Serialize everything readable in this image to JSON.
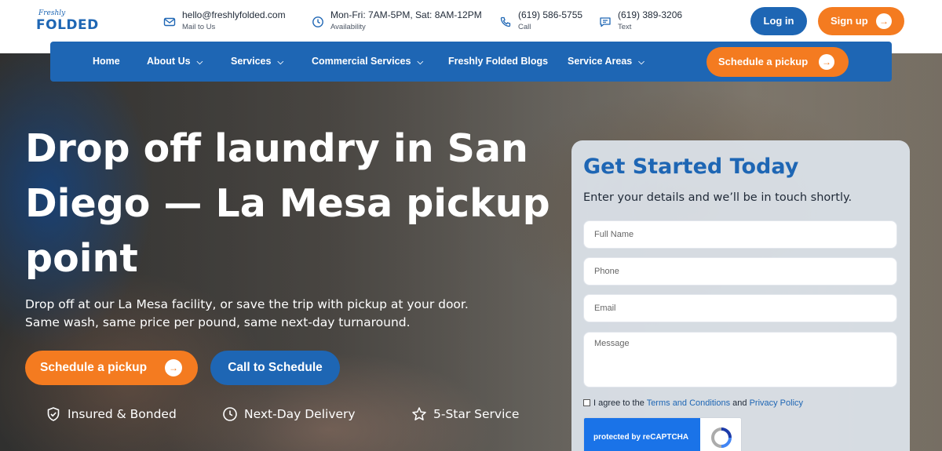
{
  "brand": {
    "logo_script": "Freshly",
    "logo_main": "FOLDED",
    "color_primary": "#1e66b4",
    "color_accent": "#f47b20"
  },
  "contacts": [
    {
      "icon": "mail-icon",
      "text": "hello@freshlyfolded.com",
      "sub": "Mail to Us"
    },
    {
      "icon": "clock-icon",
      "text": "Mon-Fri: 7AM-5PM, Sat: 8AM-12PM",
      "sub": "Availability"
    },
    {
      "icon": "phone-icon",
      "text": "(619) 586-5755",
      "sub": "Call"
    },
    {
      "icon": "message-icon",
      "text": "(619) 389-3206",
      "sub": "Text"
    }
  ],
  "header": {
    "login_label": "Log in",
    "signup_label": "Sign up"
  },
  "nav": {
    "items": [
      {
        "label": "Home",
        "dropdown": false
      },
      {
        "label": "About Us",
        "dropdown": true
      },
      {
        "label": "Services",
        "dropdown": true
      },
      {
        "label": "Commercial Services",
        "dropdown": true
      },
      {
        "label": "Freshly Folded Blogs",
        "dropdown": false
      },
      {
        "label": "Service Areas",
        "dropdown": true
      }
    ],
    "cta_label": "Schedule a pickup"
  },
  "hero": {
    "title": "Drop off laundry in San Diego — La Mesa pickup point",
    "subtitle": "Drop off at our La Mesa facility, or save the trip with pickup at your door. Same wash, same price per pound, same next-day turnaround.",
    "primary_cta": "Schedule a pickup",
    "secondary_cta": "Call to Schedule",
    "features": [
      {
        "icon": "shield-check-icon",
        "label": "Insured & Bonded"
      },
      {
        "icon": "clock-icon",
        "label": "Next-Day Delivery"
      },
      {
        "icon": "star-icon",
        "label": "5-Star Service"
      }
    ]
  },
  "form": {
    "title": "Get Started Today",
    "subtitle": "Enter your details and we’ll be in touch shortly.",
    "fields": {
      "name_placeholder": "Full Name",
      "phone_placeholder": "Phone",
      "email_placeholder": "Email",
      "message_placeholder": "Message"
    },
    "agree": {
      "prefix": "I agree to the",
      "terms_link": "Terms and Conditions",
      "and": "and",
      "privacy_link": "Privacy Policy"
    },
    "recaptcha_label": "protected by reCAPTCHA"
  }
}
